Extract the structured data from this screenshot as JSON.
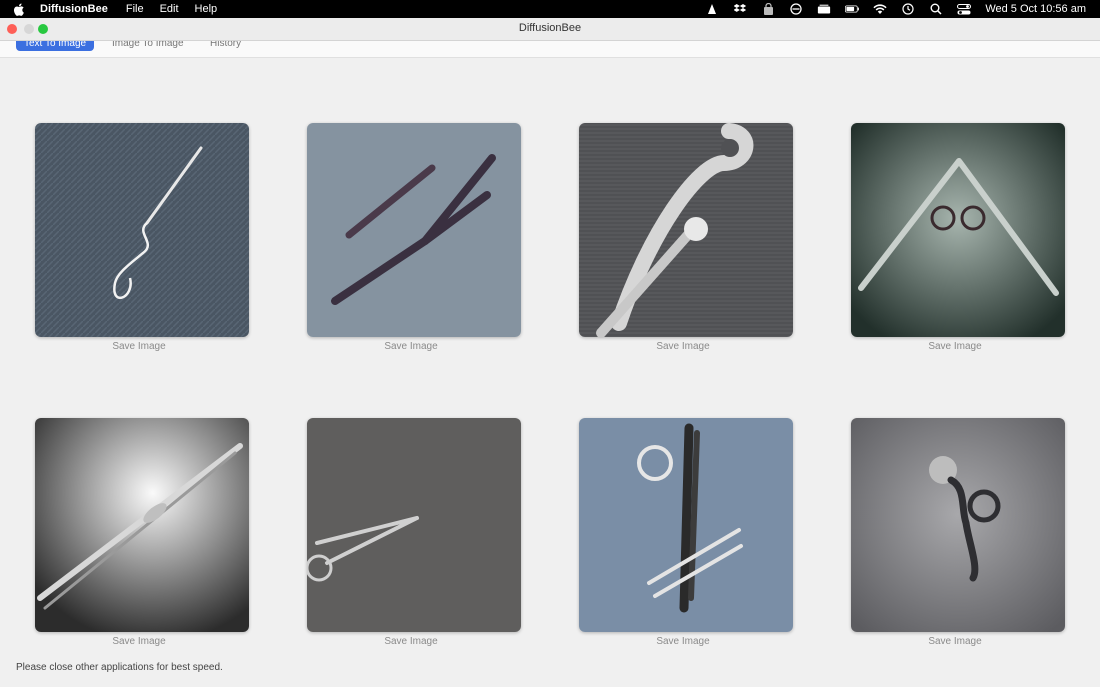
{
  "menubar": {
    "app_name": "DiffusionBee",
    "items": [
      "File",
      "Edit",
      "Help"
    ],
    "clock": "Wed 5 Oct  10:56 am",
    "status_icons": [
      "vlc-icon",
      "dropbox-icon",
      "security-icon",
      "focus-icon",
      "stage-manager-icon",
      "battery-icon",
      "wifi-icon",
      "time-machine-icon",
      "search-icon",
      "control-center-icon"
    ]
  },
  "window": {
    "title": "DiffusionBee"
  },
  "tabs": [
    {
      "label": "Text To Image",
      "active": true
    },
    {
      "label": "Image To Image",
      "active": false
    },
    {
      "label": "History",
      "active": false
    }
  ],
  "gallery": {
    "save_label": "Save Image",
    "images": [
      {
        "icon": "scissors-image",
        "bg": "#4a5663"
      },
      {
        "icon": "scissors-image",
        "bg": "#8593a0"
      },
      {
        "icon": "scissors-image",
        "bg": "#505154"
      },
      {
        "icon": "scissors-image",
        "bg": "#43504c"
      },
      {
        "icon": "scissors-image",
        "bg": "#6a6a6a"
      },
      {
        "icon": "scissors-image",
        "bg": "#5f5e5d"
      },
      {
        "icon": "scissors-image",
        "bg": "#7a8ea6"
      },
      {
        "icon": "scissors-image",
        "bg": "#7d7d80"
      }
    ]
  },
  "footer": {
    "note": "Please close other applications for best speed."
  }
}
